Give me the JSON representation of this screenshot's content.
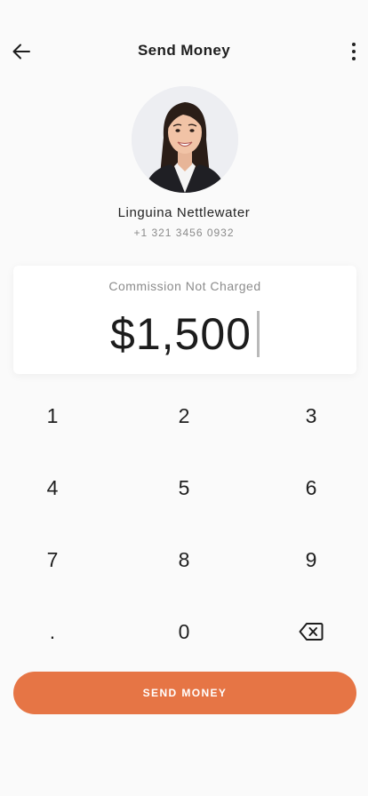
{
  "header": {
    "title": "Send Money",
    "back_icon": "arrow-left-icon",
    "more_icon": "more-vertical-icon"
  },
  "recipient": {
    "name": "Linguina Nettlewater",
    "phone": "+1 321 3456 0932"
  },
  "amount_card": {
    "commission_text": "Commission Not Charged",
    "amount": "$1,500"
  },
  "keypad": {
    "keys": [
      "1",
      "2",
      "3",
      "4",
      "5",
      "6",
      "7",
      "8",
      "9",
      ".",
      "0"
    ],
    "backspace_icon": "backspace-icon"
  },
  "actions": {
    "send_label": "SEND MONEY"
  },
  "colors": {
    "accent": "#e67545",
    "background": "#fafafa"
  }
}
